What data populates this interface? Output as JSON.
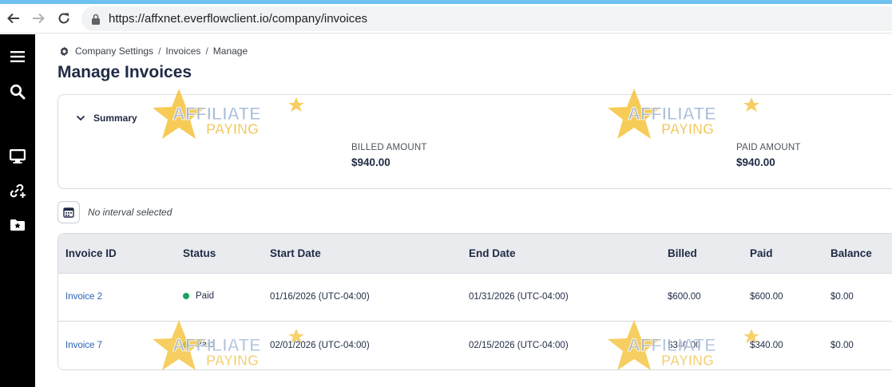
{
  "browser": {
    "url": "https://affxnet.everflowclient.io/company/invoices"
  },
  "sidebar": {
    "items": [
      {
        "icon": "menu-icon"
      },
      {
        "icon": "search-icon"
      },
      {
        "icon": "monitor-icon"
      },
      {
        "icon": "link-add-icon"
      },
      {
        "icon": "folder-star-icon"
      }
    ]
  },
  "breadcrumb": {
    "items": [
      "Company Settings",
      "Invoices",
      "Manage"
    ],
    "separator": "/"
  },
  "page": {
    "title": "Manage Invoices"
  },
  "summary": {
    "toggle_label": "Summary",
    "billed_label": "BILLED AMOUNT",
    "billed_value": "$940.00",
    "paid_label": "PAID AMOUNT",
    "paid_value": "$940.00"
  },
  "interval": {
    "text": "No interval selected"
  },
  "table": {
    "columns": [
      "Invoice ID",
      "Status",
      "Start Date",
      "End Date",
      "Billed",
      "Paid",
      "Balance"
    ],
    "rows": [
      {
        "id": "Invoice 2",
        "status": "Paid",
        "start": "01/16/2026 (UTC-04:00)",
        "end": "01/31/2026 (UTC-04:00)",
        "billed": "$600.00",
        "paid": "$600.00",
        "balance": "$0.00"
      },
      {
        "id": "Invoice 7",
        "status": "Paid",
        "start": "02/01/2026 (UTC-04:00)",
        "end": "02/15/2026 (UTC-04:00)",
        "billed": "$340.00",
        "paid": "$340.00",
        "balance": "$0.00"
      }
    ]
  },
  "watermark": {
    "line1": "AFFILIATE",
    "line2": "PAYING"
  },
  "colors": {
    "accent_bar": "#6ec1f0",
    "title": "#1f2a44",
    "link": "#2a63b5",
    "status_paid": "#1aa260",
    "sidebar": "#000000"
  }
}
